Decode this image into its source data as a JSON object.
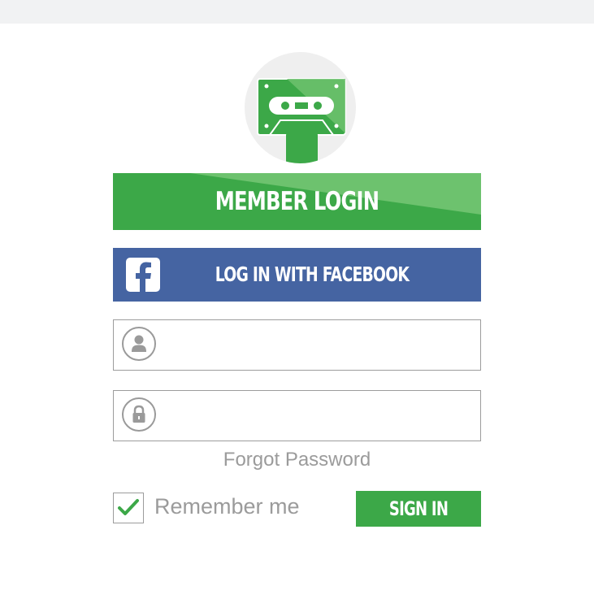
{
  "header": {
    "title": "MEMBER LOGIN"
  },
  "logo": {
    "icon": "cassette-tape-icon"
  },
  "facebook": {
    "label": "LOG IN WITH FACEBOOK",
    "icon": "facebook-icon"
  },
  "username": {
    "value": "",
    "placeholder": "",
    "icon": "user-icon"
  },
  "password": {
    "value": "",
    "placeholder": "",
    "icon": "lock-icon"
  },
  "forgot_password": "Forgot Password",
  "remember_me": {
    "label": "Remember me",
    "checked": true
  },
  "sign_in": "SIGN IN",
  "colors": {
    "brand_green": "#3ca848",
    "facebook_blue": "#4564a2",
    "muted_text": "#9b9b9b",
    "top_bar": "#f1f2f3"
  }
}
